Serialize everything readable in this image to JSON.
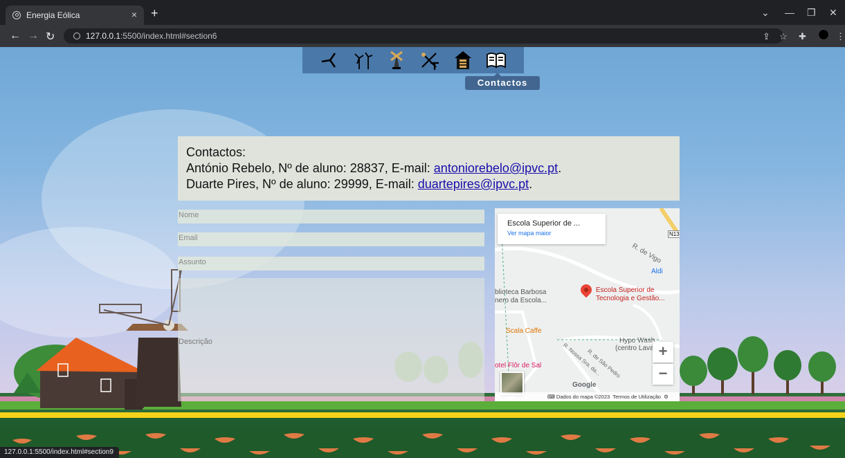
{
  "browser": {
    "tab_title": "Energia Eólica",
    "tab_close": "×",
    "new_tab": "+",
    "url_host": "127.0.0.1",
    "url_rest": ":5500/index.html#section6",
    "status_url": "127.0.0.1:5500/index.html#section9"
  },
  "nav": {
    "items": [
      {
        "icon": "wind-turbine-icon"
      },
      {
        "icon": "turbines-icon"
      },
      {
        "icon": "windmill-icon"
      },
      {
        "icon": "tools-icon"
      },
      {
        "icon": "mill-house-icon"
      },
      {
        "icon": "book-icon"
      }
    ],
    "tooltip": "Contactos"
  },
  "contact": {
    "heading": "Contactos:",
    "line1_prefix": "António Rebelo, Nº de aluno: 28837, E-mail: ",
    "line1_email": "antoniorebelo@ipvc.pt",
    "line2_prefix": "Duarte Pires, Nº de aluno: 29999, E-mail: ",
    "line2_email": "duartepires@ipvc.pt",
    "period": "."
  },
  "form": {
    "name_placeholder": "Nome",
    "email_placeholder": "Email",
    "subject_placeholder": "Assunto",
    "description_placeholder": "Descrição"
  },
  "map": {
    "place_title": "Escola Superior de ...",
    "larger_map_link": "Ver mapa maior",
    "labels": {
      "pin": "Escola Superior de",
      "pin2": "Tecnologia e Gestão...",
      "library": "blioteca Barbosa",
      "library2": "nero da Escola...",
      "aldi": "Aldi",
      "road_vigo": "R. de Vigo",
      "scala": "Scala Caffe",
      "hypo": "Hypo Wash",
      "hypo2": "(centro Lavagem",
      "hotel": "otel Flôr de Sal",
      "road1": "R. Nossa Sra. da...",
      "road2": "R. de São Pedro",
      "n13": "N13",
      "google": "Google"
    },
    "zoom_in": "+",
    "zoom_out": "−",
    "footer_data": "Dados do mapa ©2023",
    "footer_terms": "Termos de Utilização"
  }
}
